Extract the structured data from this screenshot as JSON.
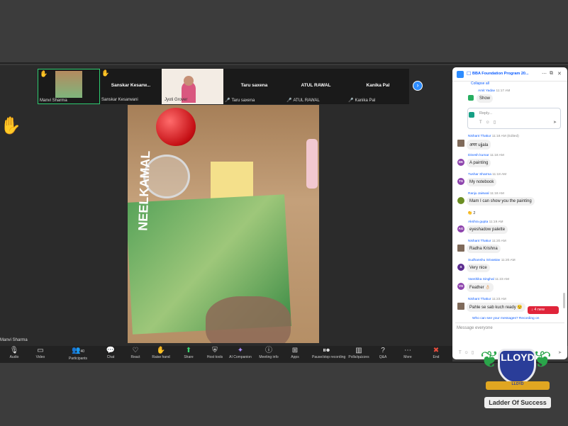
{
  "gallery": {
    "tiles": [
      {
        "name": "Manvi Sharma",
        "big": ""
      },
      {
        "name": "Sanskar Kesarwani",
        "big": "Sanskar Kesarw..."
      },
      {
        "name": "Jyoti Grover",
        "big": ""
      },
      {
        "name": "Taru saxena",
        "big": "Taru saxena"
      },
      {
        "name": "ATUL RAWAL",
        "big": "ATUL RAWAL"
      },
      {
        "name": "Kanika Pal",
        "big": "Kanika Pal"
      }
    ]
  },
  "self_label": "Manvi Sharma",
  "video_brand": "NEELKAMAL",
  "toolbar": {
    "items": [
      {
        "label": "Audio",
        "icon": "microphone-icon"
      },
      {
        "label": "Video",
        "icon": "camera-icon"
      },
      {
        "label": "Participants",
        "count": "40",
        "icon": "participants-icon"
      },
      {
        "label": "Chat",
        "icon": "chat-icon"
      },
      {
        "label": "React",
        "icon": "heart-icon"
      },
      {
        "label": "Raise hand",
        "icon": "hand-icon"
      },
      {
        "label": "Share",
        "icon": "share-icon"
      },
      {
        "label": "Host tools",
        "icon": "shield-icon"
      },
      {
        "label": "AI Companion",
        "icon": "sparkle-icon"
      },
      {
        "label": "Meeting info",
        "icon": "info-icon"
      },
      {
        "label": "Apps",
        "icon": "apps-icon"
      },
      {
        "label": "Pause/stop recording",
        "icon": "record-icon"
      },
      {
        "label": "Polls/quizzes",
        "icon": "polls-icon"
      },
      {
        "label": "Q&A",
        "icon": "qa-icon"
      },
      {
        "label": "More",
        "icon": "more-icon"
      },
      {
        "label": "End",
        "icon": "end-icon"
      }
    ]
  },
  "chat": {
    "title": "BBA Foundation Program 20...",
    "collapse": "Collapse all",
    "reply_placeholder": "Reply...",
    "messages": [
      {
        "sender": "Amit Yadav",
        "time": "11:17 AM",
        "text": "Show",
        "initials": "AY",
        "color": "#27ae60"
      },
      {
        "sender": "Nishant Thakur",
        "time": "11:18 AM (Edited)",
        "text": "अमर ujjala",
        "initials": "NT",
        "color": "#7f6a5a"
      },
      {
        "sender": "Dinesh kumar",
        "time": "11:18 AM",
        "text": "A painting",
        "initials": "DK",
        "color": "#8e44ad"
      },
      {
        "sender": "Tushar Sharma",
        "time": "11:18 AM",
        "text": "My notebook",
        "initials": "TS",
        "color": "#8e44ad"
      },
      {
        "sender": "Ranju Jaiswal",
        "time": "11:18 AM",
        "text": "Mam I can show you the painting",
        "initials": "RJ",
        "color": "#6b8e23"
      },
      {
        "sender": "Akshra gupta",
        "time": "11:19 AM",
        "text": "eyeshadow palette",
        "initials": "AG",
        "color": "#8e44ad"
      },
      {
        "sender": "Nishant Thakur",
        "time": "11:20 AM",
        "text": "Radha Krishna",
        "initials": "NT",
        "color": "#7f6a5a"
      },
      {
        "sender": "Sudhanshu Srivastav",
        "time": "11:20 AM",
        "text": "Very nice",
        "initials": "S",
        "color": "#5b2c8f"
      },
      {
        "sender": "Vanshika Singhal",
        "time": "11:23 AM",
        "text": "Feather 👌🏻",
        "initials": "VS",
        "color": "#8e44ad"
      },
      {
        "sender": "Nishant Thakur",
        "time": "11:23 AM",
        "text": "Pahle se sab kuch ready 😉",
        "initials": "NT",
        "color": "#7f6a5a"
      }
    ],
    "reaction": "👏 2",
    "new_badge": "↓ 4 new",
    "who_see": "Who can see your messages? Recording on",
    "input_placeholder": "Message everyone"
  },
  "watermark": {
    "brand": "LLOYD",
    "ribbon": "LLOYD",
    "tagline": "Ladder Of Success"
  }
}
